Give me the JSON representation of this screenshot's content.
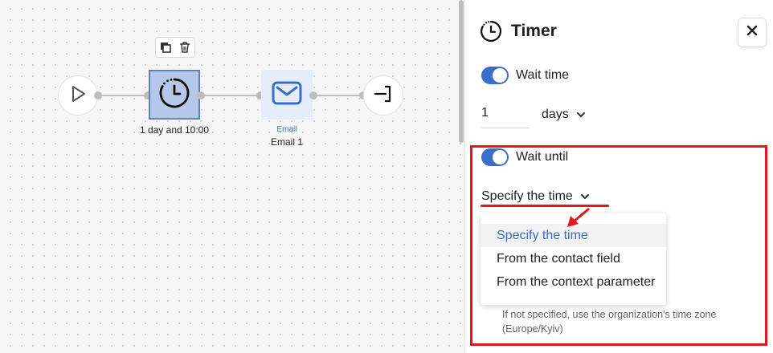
{
  "canvas": {
    "nodes": {
      "start": {
        "icon": "play-icon"
      },
      "timer": {
        "icon": "timer-icon",
        "label": "1 day and 10:00",
        "toolbar": [
          "copy-icon",
          "trash-icon"
        ]
      },
      "email": {
        "icon": "envelope-icon",
        "type": "Email",
        "label": "Email 1"
      },
      "end": {
        "icon": "exit-icon"
      }
    }
  },
  "panel": {
    "title": "Timer",
    "title_icon": "timer-icon",
    "close_icon": "close-icon",
    "wait_time": {
      "label": "Wait time",
      "enabled": true,
      "value": "1",
      "unit": "days"
    },
    "wait_until": {
      "label": "Wait until",
      "enabled": true,
      "mode_selected": "Specify the time",
      "options": [
        "Specify the time",
        "From the contact field",
        "From the context parameter"
      ],
      "hint": "If not specified, use the organization's time zone (Europe/Kyiv)"
    }
  },
  "colors": {
    "accent": "#3b6fc7",
    "highlight": "#e8141c",
    "timer_node": "#b6c8ea",
    "email_node": "#e5edfa"
  }
}
